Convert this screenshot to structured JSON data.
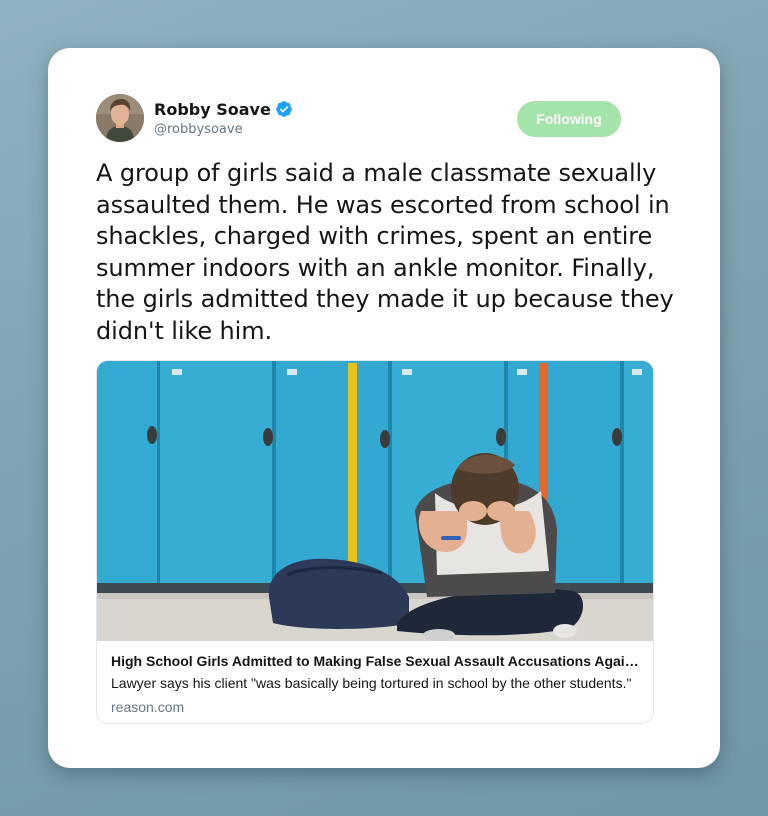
{
  "tweet": {
    "author": {
      "display_name": "Robby Soave",
      "handle": "@robbysoave",
      "verified": true,
      "verified_color": "#1da1f2"
    },
    "follow_button": {
      "label": "Following",
      "color": "#a4e3a9"
    },
    "text": "A group of girls said a male classmate sexually assaulted them. He was escorted from school in shackles, charged with crimes, spent an entire summer indoors with an ankle monitor. Finally, the girls admitted they made it up because they didn't like him.",
    "link_card": {
      "title": "High School Girls Admitted to Making False Sexual Assault Accusations Against a Classmate",
      "description": "Lawyer says his client \"was basically being tortured in school by the other students.\"",
      "domain": "reason.com"
    }
  }
}
